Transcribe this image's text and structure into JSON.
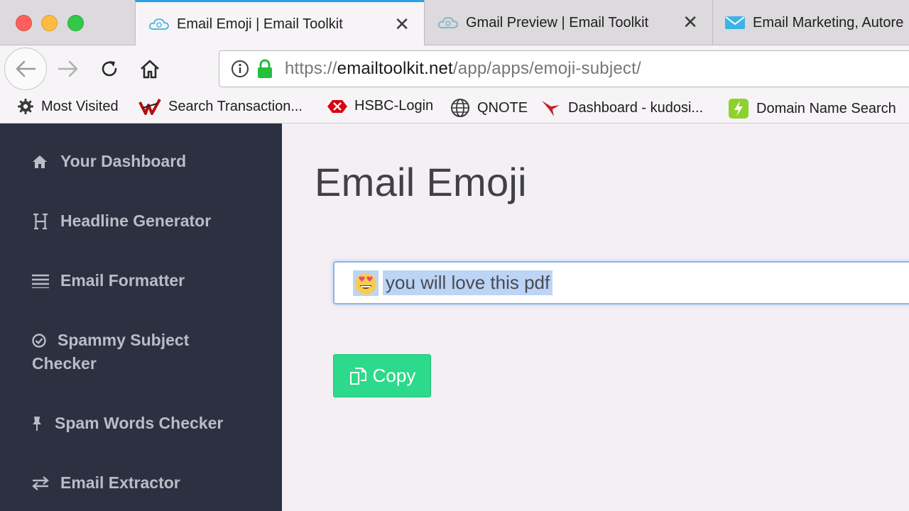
{
  "browser": {
    "tabs": [
      {
        "title": "Email Emoji | Email Toolkit",
        "active": true,
        "icon": "cloud-icon",
        "closable": true
      },
      {
        "title": "Gmail Preview | Email Toolkit",
        "active": false,
        "icon": "cloud-icon",
        "closable": true
      },
      {
        "title": "Email Marketing, Autore",
        "active": false,
        "icon": "envelope-icon",
        "closable": false
      }
    ],
    "close_glyph": "✕",
    "url": {
      "scheme": "https://",
      "host": "emailtoolkit.net",
      "path": "/app/apps/emoji-subject/"
    },
    "bookmarks": [
      {
        "label": "Most Visited",
        "icon": "gear-icon"
      },
      {
        "label": "Search Transaction...",
        "icon": "brand-icon"
      },
      {
        "label": "HSBC-Login",
        "icon": "hsbc-icon"
      },
      {
        "label": "QNOTE",
        "icon": "globe-icon"
      },
      {
        "label": "Dashboard - kudosi...",
        "icon": "bird-icon"
      },
      {
        "label": "Domain Name Search",
        "icon": "bolt-icon"
      }
    ]
  },
  "sidebar": {
    "items": [
      {
        "label": "Your Dashboard",
        "icon": "home-icon"
      },
      {
        "label": "Headline Generator",
        "icon": "heading-icon"
      },
      {
        "label": "Email Formatter",
        "icon": "lines-icon"
      },
      {
        "label": "Spammy Subject Checker",
        "icon": "check-circle-icon"
      },
      {
        "label": "Spam Words Checker",
        "icon": "pin-icon"
      },
      {
        "label": "Email Extractor",
        "icon": "exchange-icon"
      }
    ]
  },
  "main": {
    "title": "Email Emoji",
    "subject_value": "you will love this pdf",
    "emoji": "😍",
    "copy_label": "Copy"
  },
  "colors": {
    "sidebar_bg": "#2b3140",
    "accent_green": "#2dd98a",
    "selection": "#bcd4f5",
    "tab_accent": "#2b9ee8"
  }
}
